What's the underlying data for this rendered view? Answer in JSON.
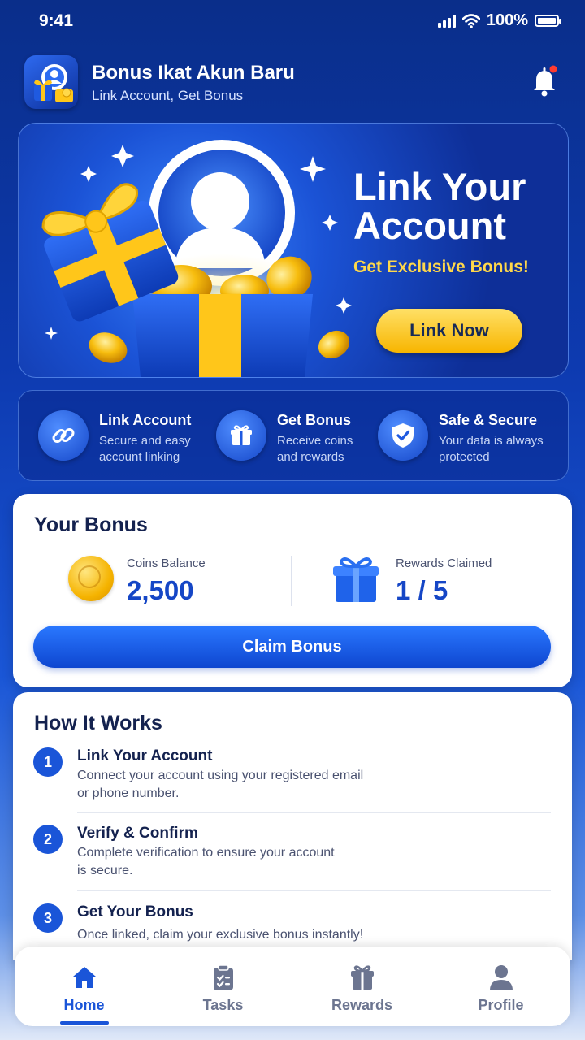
{
  "status_bar": {
    "time": "9:41",
    "battery": "100%"
  },
  "header": {
    "title": "Bonus Ikat Akun Baru",
    "subtitle": "Link Account, Get Bonus",
    "notification_dot_color": "#ff3b30"
  },
  "hero": {
    "title": "Link Your Account",
    "subtitle": "Get Exclusive Bonus!",
    "cta": "Link Now"
  },
  "features": [
    {
      "icon": "link-icon",
      "title": "Link Account",
      "desc_line1": "Secure and easy",
      "desc_line2": "account linking"
    },
    {
      "icon": "gift-icon",
      "title": "Get Bonus",
      "desc_line1": "Receive coins",
      "desc_line2": "and rewards"
    },
    {
      "icon": "shield-check-icon",
      "title": "Safe & Secure",
      "desc_line1": "Your data is always",
      "desc_line2": "protected"
    }
  ],
  "bonus": {
    "title": "Your Bonus",
    "coins_label": "Coins Balance",
    "coins_value": "2,500",
    "rewards_label": "Rewards Claimed",
    "rewards_value": "1 / 5",
    "claim_button": "Claim Bonus"
  },
  "how_it_works": {
    "title": "How It Works",
    "steps": [
      {
        "num": "1",
        "title": "Link Your Account",
        "desc_line1": "Connect your account using your registered email",
        "desc_line2": "or phone number."
      },
      {
        "num": "2",
        "title": "Verify & Confirm",
        "desc_line1": "Complete verification to ensure your account",
        "desc_line2": "is secure."
      },
      {
        "num": "3",
        "title": "Get Your Bonus",
        "desc_line1": "Once linked, claim your exclusive bonus instantly!",
        "desc_line2": ""
      }
    ]
  },
  "bottom_nav": [
    {
      "label": "Home",
      "icon": "home-icon",
      "active": true
    },
    {
      "label": "Tasks",
      "icon": "clipboard-icon",
      "active": false
    },
    {
      "label": "Rewards",
      "icon": "gift-icon",
      "active": false
    },
    {
      "label": "Profile",
      "icon": "user-icon",
      "active": false
    }
  ],
  "colors": {
    "primary": "#1a55d8",
    "accent_yellow": "#ffd84a",
    "inactive_nav": "#6c7590"
  }
}
